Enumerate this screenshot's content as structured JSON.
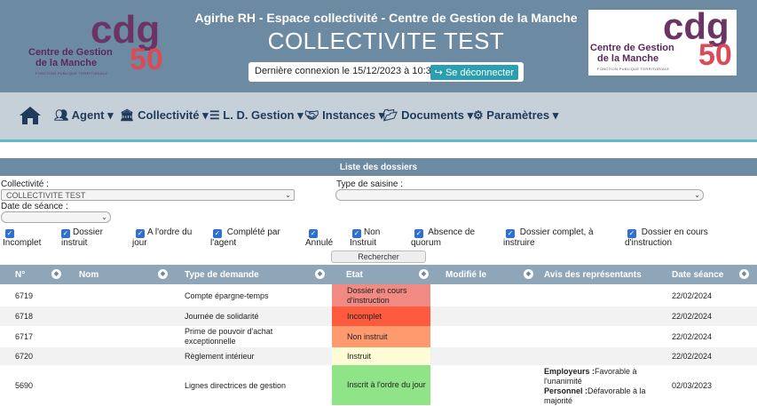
{
  "header": {
    "title_line": "Agirhe RH - Espace collectivité - Centre de Gestion de la Manche",
    "collectivite_name": "COLLECTIVITE TEST",
    "last_connection": "Dernière connexion le 15/12/2023 à 10:39",
    "logout_label": "Se déconnecter",
    "logo": {
      "cdg": "cdg",
      "number": "50",
      "line1": "Centre de Gestion",
      "line2": "de la Manche",
      "tagline": "FONCTION PUBLIQUE TERRITORIALE"
    }
  },
  "nav": {
    "home_icon": "home-icon",
    "items": [
      {
        "label": "Agent",
        "icon": "users-icon"
      },
      {
        "label": "Collectivité",
        "icon": "bank-icon"
      },
      {
        "label": "L. D. Gestion",
        "icon": "list-icon"
      },
      {
        "label": "Instances",
        "icon": "handshake-icon"
      },
      {
        "label": "Documents",
        "icon": "folder-icon"
      },
      {
        "label": "Paramètres",
        "icon": "gears-icon"
      }
    ]
  },
  "list": {
    "title": "Liste des dossiers",
    "filters": {
      "collectivite_label": "Collectivité :",
      "collectivite_value": "COLLECTIVITE TEST",
      "type_saisine_label": "Type de saisine :",
      "type_saisine_value": "",
      "date_seance_label": "Date de séance :",
      "date_seance_value": ""
    },
    "checkboxes": [
      {
        "l1": "",
        "l2": "Incomplet",
        "checked": true
      },
      {
        "l1": "Dossier",
        "l2": "instruit",
        "checked": true
      },
      {
        "l1": "A l'ordre du",
        "l2": "jour",
        "checked": true
      },
      {
        "l1": "Complété par",
        "l2": "l'agent",
        "checked": true
      },
      {
        "l1": "",
        "l2": "Annulé",
        "checked": true
      },
      {
        "l1": "Non",
        "l2": "Instruit",
        "checked": true
      },
      {
        "l1": "Absence de",
        "l2": "quorum",
        "checked": true
      },
      {
        "l1": "Dossier complet, à",
        "l2": "instruire",
        "checked": true
      },
      {
        "l1": "Dossier en cours",
        "l2": "d'instruction",
        "checked": true
      }
    ],
    "search_label": "Rechercher",
    "columns": [
      "N°",
      "Nom",
      "Type de demande",
      "Etat",
      "Modifié le",
      "Avis des représentants",
      "Date séance"
    ],
    "rows": [
      {
        "num": "6719",
        "nom": "",
        "type": "Compte épargne-temps",
        "etat": "Dossier en cours d'instruction",
        "etat_color": "#f08a82",
        "modifie": "",
        "avis": "",
        "date": "22/02/2024"
      },
      {
        "num": "6718",
        "nom": "",
        "type": "Journée de solidarité",
        "etat": "Incomplet",
        "etat_color": "#fd5a3e",
        "modifie": "",
        "avis": "",
        "date": "22/02/2024"
      },
      {
        "num": "6717",
        "nom": "",
        "type": "Prime de pouvoir d'achat exceptionnelle",
        "etat": "Non instruit",
        "etat_color": "#ff9a6f",
        "modifie": "",
        "avis": "",
        "date": "22/02/2024"
      },
      {
        "num": "6720",
        "nom": "",
        "type": "Règlement intérieur",
        "etat": "Instruit",
        "etat_color": "#fffdd6",
        "modifie": "",
        "avis": "",
        "date": "22/02/2024"
      },
      {
        "num": "5690",
        "nom": "",
        "type": "Lignes directrices de gestion",
        "etat": "Inscrit à l'ordre du jour",
        "etat_color": "#8ee486",
        "modifie": "",
        "avis_emp_label": "Employeurs :",
        "avis_emp": "Favorable à l'unanimité",
        "avis_pers_label": "Personnel :",
        "avis_pers": "Défavorable à la majorité",
        "date": "02/03/2023"
      }
    ]
  }
}
